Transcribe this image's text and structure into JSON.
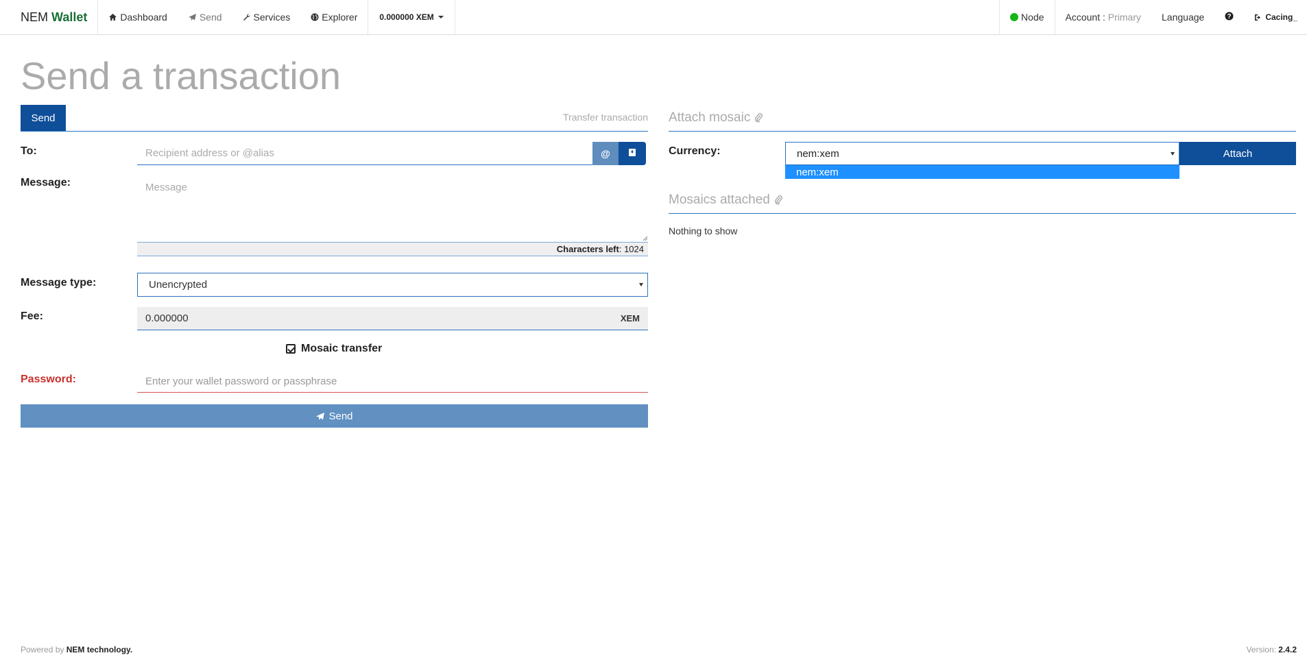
{
  "navbar": {
    "brand_part1": "NEM",
    "brand_part2": "Wallet",
    "items": [
      {
        "label": "Dashboard",
        "icon": "home-icon"
      },
      {
        "label": "Send",
        "icon": "paper-plane-icon"
      },
      {
        "label": "Services",
        "icon": "wrench-icon"
      },
      {
        "label": "Explorer",
        "icon": "globe-icon"
      }
    ],
    "balance": "0.000000 XEM",
    "node_label": "Node",
    "node_status_color": "#17b617",
    "account_label": "Account :",
    "account_value": "Primary",
    "language_label": "Language",
    "help_icon": "question-circle-icon",
    "logout_label": "Cacing_"
  },
  "page": {
    "title": "Send a transaction"
  },
  "send_form": {
    "tab_label": "Send",
    "tab_description": "Transfer transaction",
    "to_label": "To:",
    "to_placeholder": "Recipient address or @alias",
    "to_value": "",
    "alias_button": "@",
    "message_label": "Message:",
    "message_placeholder": "Message",
    "message_value": "",
    "chars_left_label": "Characters left",
    "chars_left_value": ": 1024",
    "message_type_label": "Message type:",
    "message_type_value": "Unencrypted",
    "fee_label": "Fee:",
    "fee_value": "0.000000",
    "fee_unit": "XEM",
    "mosaic_transfer_label": "Mosaic transfer",
    "mosaic_transfer_checked": true,
    "password_label": "Password:",
    "password_placeholder": "Enter your wallet password or passphrase",
    "send_button": "Send"
  },
  "mosaic_panel": {
    "attach_heading": "Attach mosaic",
    "currency_label": "Currency:",
    "currency_value": "nem:xem",
    "dropdown_options": [
      "nem:xem"
    ],
    "attach_button": "Attach",
    "attached_heading": "Mosaics attached",
    "empty_text": "Nothing to show"
  },
  "footer": {
    "powered_prefix": "Powered by",
    "powered_name": "NEM technology.",
    "version_label": "Version:",
    "version_value": "2.4.2"
  },
  "colors": {
    "primary": "#0f4e99",
    "send_button": "#6190c1",
    "dropdown_highlight": "#1e90ff",
    "brand_green": "#1b6e35",
    "error_red": "#c9302c"
  }
}
